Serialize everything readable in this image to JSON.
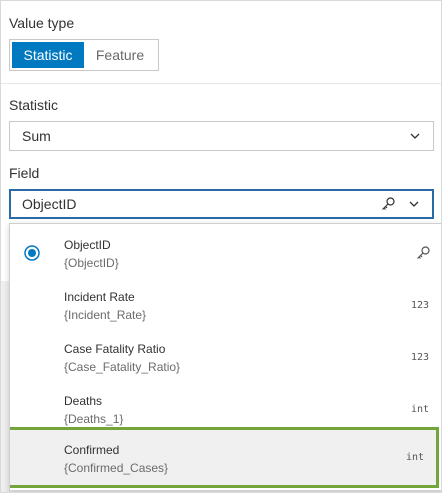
{
  "value_type": {
    "label": "Value type",
    "options": [
      "Statistic",
      "Feature"
    ],
    "selected": "Statistic"
  },
  "statistic": {
    "label": "Statistic",
    "value": "Sum"
  },
  "field": {
    "label": "Field",
    "value": "ObjectID"
  },
  "field_options": [
    {
      "name": "ObjectID",
      "sub": "{ObjectID}",
      "type_icon": "key-icon",
      "checked": true
    },
    {
      "name": "Incident Rate",
      "sub": "{Incident_Rate}",
      "type": "123"
    },
    {
      "name": "Case Fatality Ratio",
      "sub": "{Case_Fatality_Ratio}",
      "type": "123"
    },
    {
      "name": "Deaths",
      "sub": "{Deaths_1}",
      "type": "int"
    },
    {
      "name": "Confirmed",
      "sub": "{Confirmed_Cases}",
      "type": "int",
      "highlighted": true
    }
  ],
  "colors": {
    "accent": "#0079c1",
    "focus_border": "#2b6aa6",
    "highlight_border": "#72a53a"
  }
}
